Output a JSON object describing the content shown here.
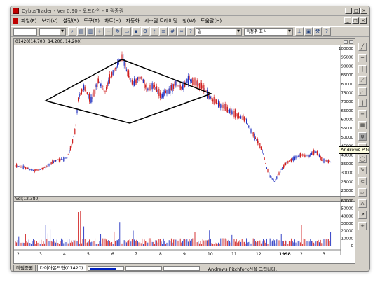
{
  "window": {
    "title": "CybosTrader - Ver 0.90 - 오프라인 - 미림증권"
  },
  "menu": {
    "items": [
      "파일(F)",
      "보기(V)",
      "설정(S)",
      "도구(T)",
      "차트(H)",
      "자동화",
      "시스템 트레이딩",
      "창(W)",
      "도움말(H)"
    ],
    "window_controls": [
      "_",
      "□",
      "×"
    ]
  },
  "toolbar": {
    "code_value": "",
    "period_select": "일",
    "indicator_select": "특정주 표식"
  },
  "chart": {
    "title": "01420(14,700, 14,200, 14,200)",
    "volume_title": "Vol(12,380)",
    "price_axis": [
      "100000",
      "95000",
      "90000",
      "85000",
      "80000",
      "75000",
      "70000",
      "65000",
      "60000",
      "55000",
      "50000",
      "45000",
      "40000",
      "35000",
      "30000",
      "25000",
      "20000"
    ],
    "volume_axis": [
      "60000",
      "50000",
      "40000",
      "30000",
      "20000",
      "10000",
      "0"
    ],
    "x_axis": [
      "2",
      "3",
      "4",
      "5",
      "6",
      "7",
      "8",
      "9",
      "10",
      "11",
      "12",
      "1998",
      "2",
      "3"
    ],
    "up_color": "#d02020",
    "down_color": "#2030c0"
  },
  "tooltip": {
    "text": "Andrews Pitchfork"
  },
  "bottom": {
    "tabs": [
      "미림증권",
      "다이아몬드형(01420)"
    ],
    "status": "Andrews Pitchfork선을 그립니다."
  },
  "icons": {
    "right_tools": [
      "line-tool-icon",
      "horizontal-line-icon",
      "vertical-line-icon",
      "trend-tool-icon",
      "fan-tool-icon",
      "bars-tool-icon",
      "channel-tool-icon",
      "grid-tool-icon",
      "pitchfork-icon",
      "arc-tool-icon",
      "ellipse-tool-icon",
      "pencil-icon",
      "magnet-icon",
      "eraser-icon",
      "text-tool-icon",
      "arrow-tool-icon",
      "cross-tool-icon"
    ]
  }
}
